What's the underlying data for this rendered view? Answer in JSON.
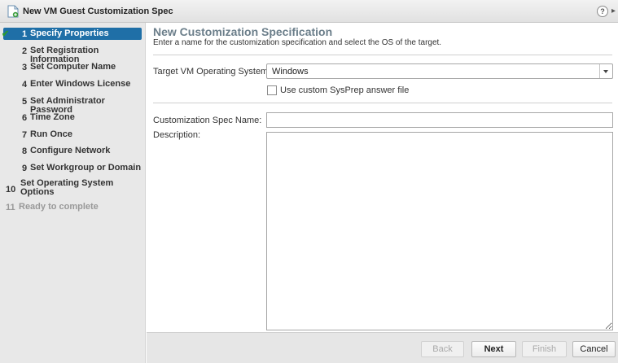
{
  "window": {
    "title": "New VM Guest Customization Spec",
    "title_icon": "new-spec-icon",
    "help_label": "?",
    "more_label": "▸"
  },
  "steps": [
    {
      "number": "1",
      "label": "Specify Properties",
      "state": "active",
      "completed": true
    },
    {
      "number": "2",
      "label": "Set Registration Information",
      "state": "normal"
    },
    {
      "number": "3",
      "label": "Set Computer Name",
      "state": "normal"
    },
    {
      "number": "4",
      "label": "Enter Windows License",
      "state": "normal"
    },
    {
      "number": "5",
      "label": "Set Administrator Password",
      "state": "normal"
    },
    {
      "number": "6",
      "label": "Time Zone",
      "state": "normal"
    },
    {
      "number": "7",
      "label": "Run Once",
      "state": "normal"
    },
    {
      "number": "8",
      "label": "Configure Network",
      "state": "normal"
    },
    {
      "number": "9",
      "label": "Set Workgroup or Domain",
      "state": "normal"
    },
    {
      "number": "10",
      "label_line1": "Set Operating System",
      "label_line2": "Options",
      "state": "normal"
    },
    {
      "number": "11",
      "label": "Ready to complete",
      "state": "disabled"
    }
  ],
  "check_mark": "✔",
  "page": {
    "title": "New Customization Specification",
    "subtitle": "Enter a name for the customization specification and select the OS of the target."
  },
  "form": {
    "os_label": "Target VM Operating System:",
    "os_value": "Windows",
    "sysprep_label": "Use custom SysPrep answer file",
    "sysprep_checked": false,
    "name_label": "Customization Spec Name:",
    "name_value": "",
    "description_label": "Description:",
    "description_value": ""
  },
  "buttons": {
    "back": "Back",
    "next": "Next",
    "finish": "Finish",
    "cancel": "Cancel"
  },
  "colors": {
    "active_step": "#1f6fa7",
    "check": "#2e9a2e",
    "title": "#6b7e8a"
  }
}
